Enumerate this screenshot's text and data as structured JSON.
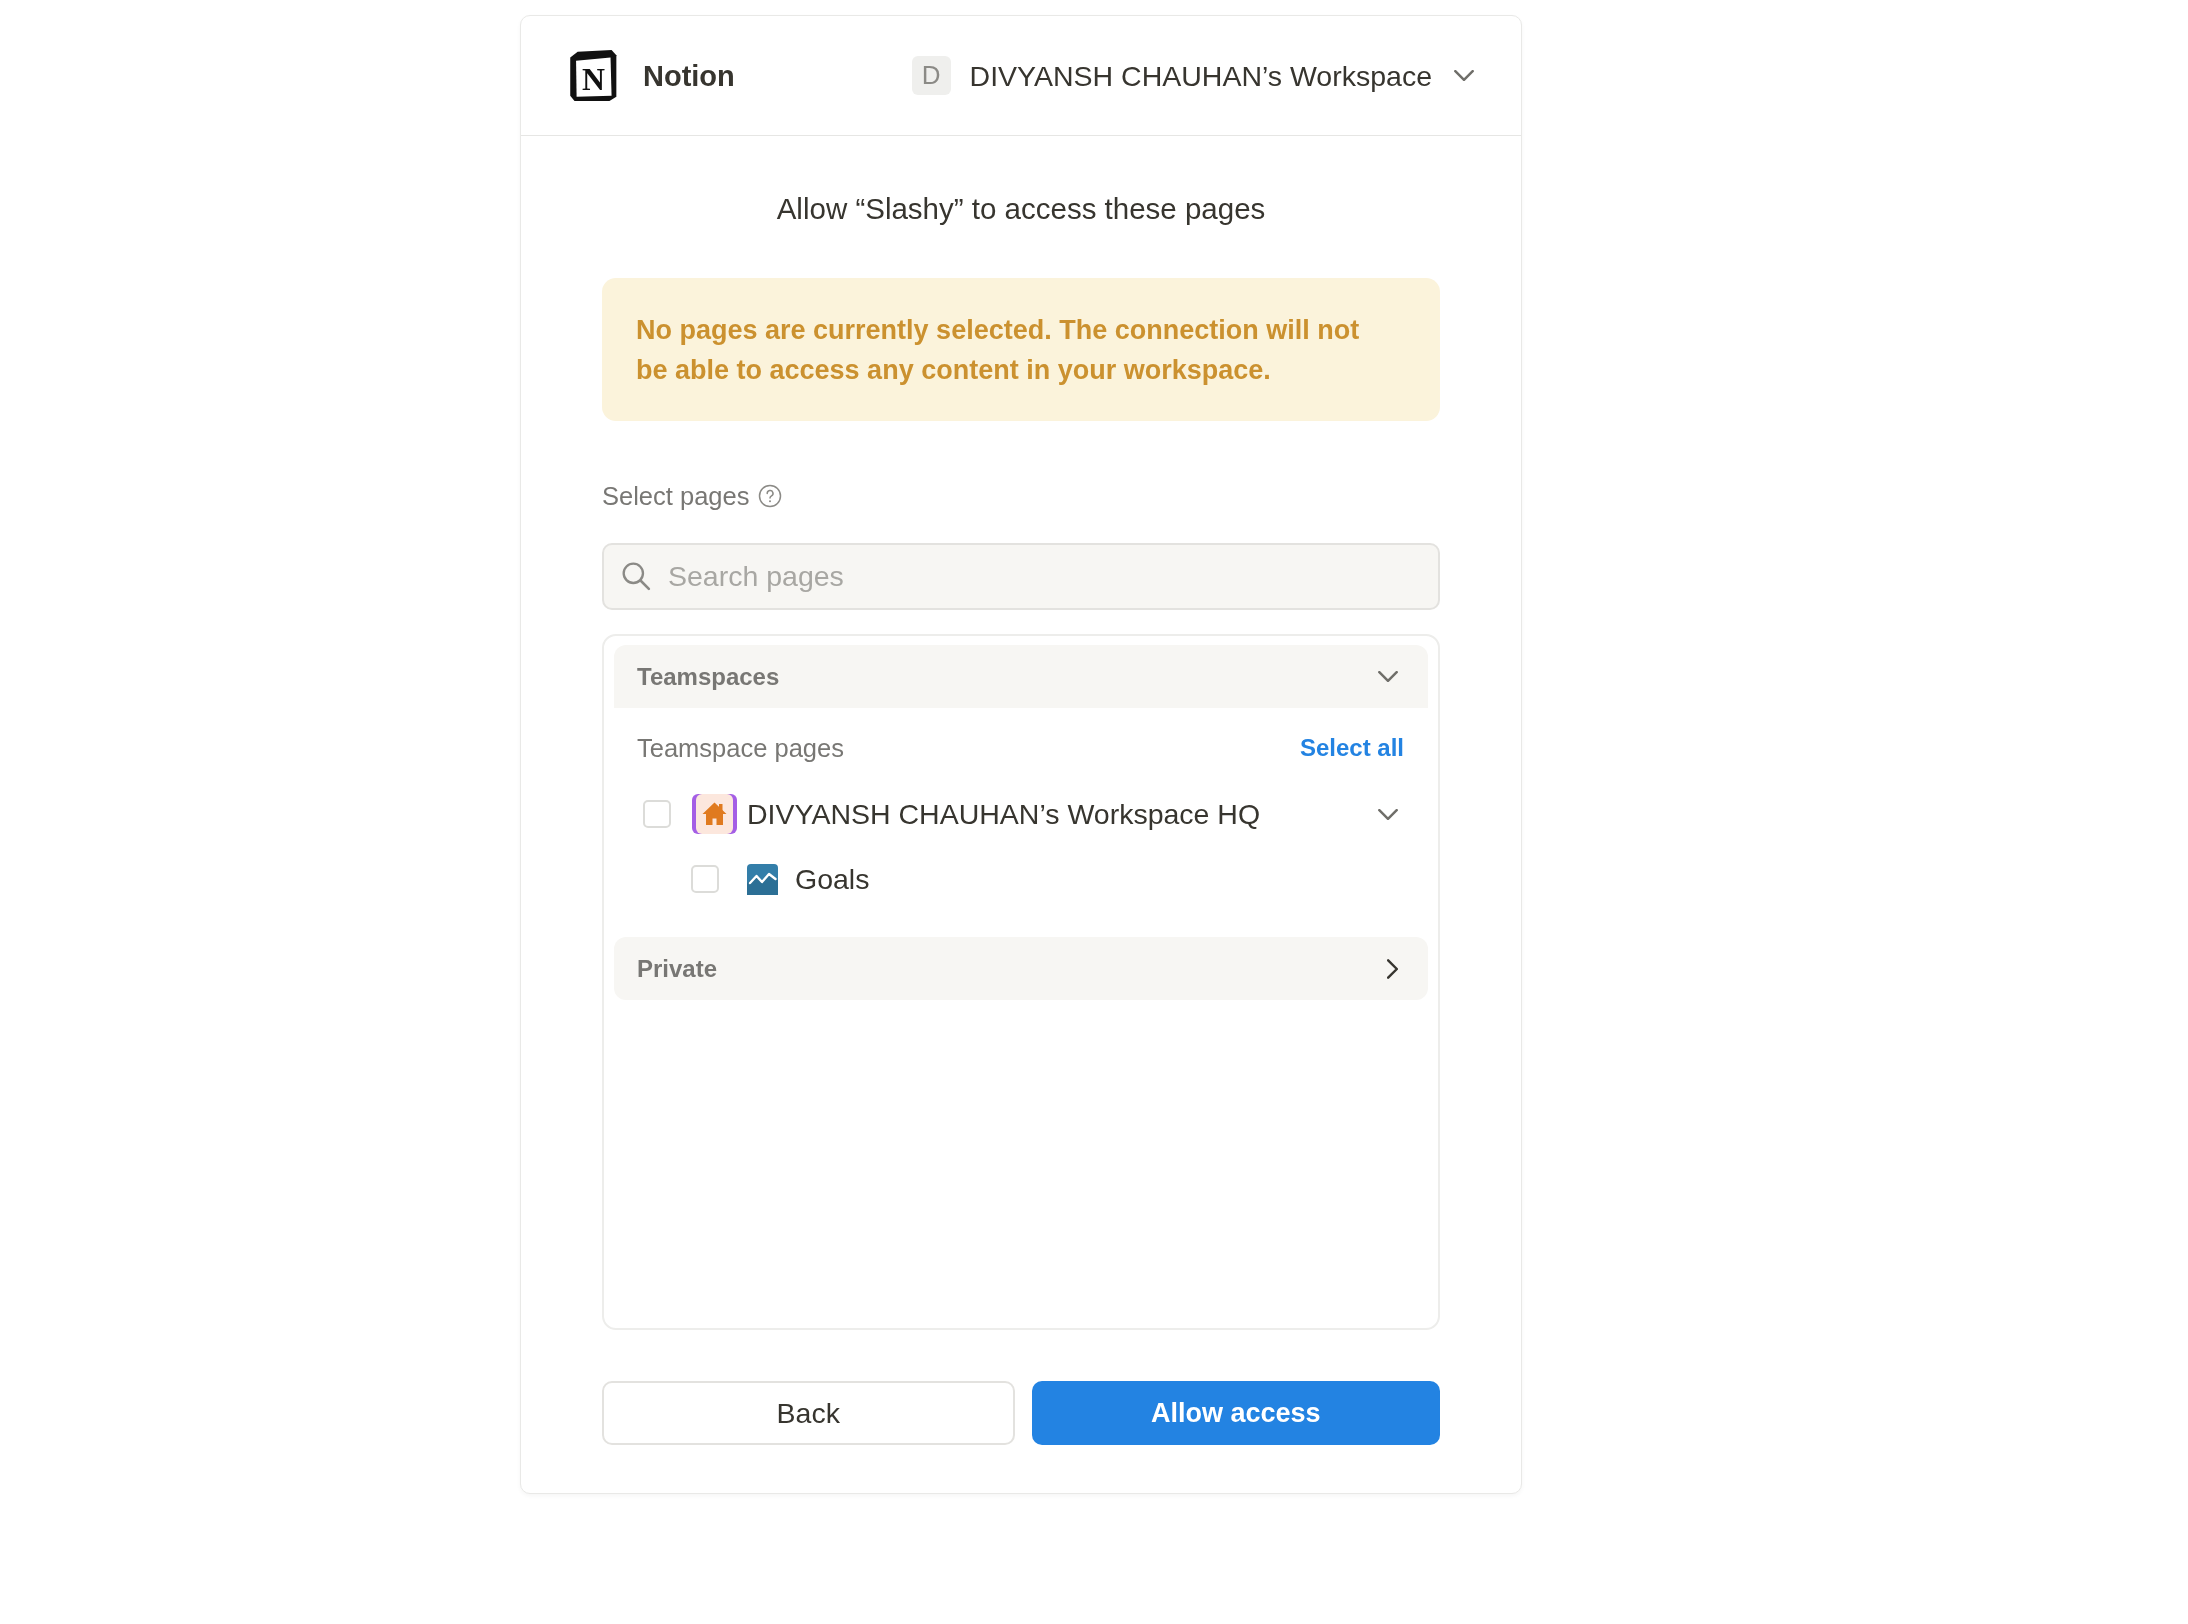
{
  "header": {
    "logo_mark": "N",
    "app_name": "Notion",
    "workspace": {
      "initial": "D",
      "name": "DIVYANSH CHAUHAN’s Workspace"
    }
  },
  "title": "Allow “Slashy” to access these pages",
  "warning": "No pages are currently selected. The connection will not be able to access any content in your workspace.",
  "select_pages": {
    "label": "Select pages"
  },
  "search": {
    "placeholder": "Search pages"
  },
  "sections": [
    {
      "label": "Teamspaces",
      "expanded": true,
      "group_label": "Teamspace pages",
      "select_all": "Select all",
      "pages": [
        {
          "title": "DIVYANSH CHAUHAN’s Workspace HQ",
          "checked": false,
          "expanded": true,
          "children": [
            {
              "title": "Goals",
              "checked": false
            }
          ]
        }
      ]
    },
    {
      "label": "Private",
      "expanded": false
    }
  ],
  "buttons": [
    {
      "label": "Back",
      "kind": "secondary"
    },
    {
      "label": "Allow access",
      "kind": "primary"
    }
  ]
}
